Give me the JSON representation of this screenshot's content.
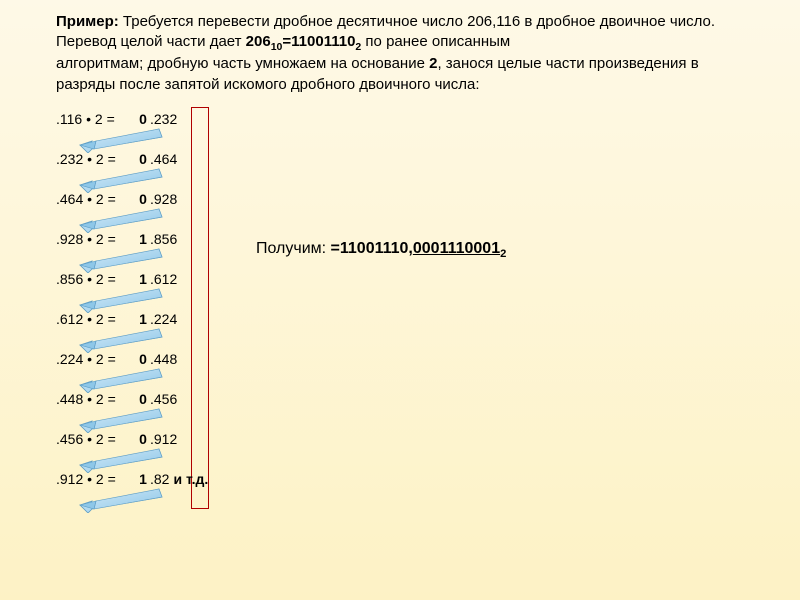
{
  "intro": {
    "example_label": "Пример:",
    "example_text": " Требуется перевести дробное десятичное число 206,116 в дробное двоичное число.",
    "line2_a": "Перевод целой части дает ",
    "int_part": "206",
    "int_base": "10",
    "eq": "=",
    "bin_part": "11001110",
    "bin_base": "2",
    "line2_b": " по ранее описанным",
    "line3": "алгоритмам; дробную часть умножаем на основание ",
    "base2": "2",
    "line3_b": ", занося целые части произведения в разряды после запятой искомого дробного двоичного числа:"
  },
  "calcs": [
    {
      "lhs": ".116 • 2 = ",
      "d": "0",
      "rhs": ".232"
    },
    {
      "lhs": ".232 • 2 = ",
      "d": "0",
      "rhs": ".464"
    },
    {
      "lhs": ".464 • 2 = ",
      "d": "0",
      "rhs": ".928"
    },
    {
      "lhs": ".928 • 2 = ",
      "d": "1",
      "rhs": ".856"
    },
    {
      "lhs": ".856 • 2 = ",
      "d": "1",
      "rhs": ".612"
    },
    {
      "lhs": ".612 • 2 = ",
      "d": "1",
      "rhs": ".224"
    },
    {
      "lhs": ".224 • 2 = ",
      "d": "0",
      "rhs": ".448"
    },
    {
      "lhs": ".448 • 2 = ",
      "d": "0",
      "rhs": ".456"
    },
    {
      "lhs": ".456 • 2 = ",
      "d": "0",
      "rhs": ".912"
    },
    {
      "lhs": ".912 • 2 = ",
      "d": "1",
      "rhs": ".82",
      "etc": "  и т.д."
    }
  ],
  "result": {
    "label": "Получим: ",
    "eq": "=11001110,",
    "frac": "0001110001",
    "base": "2"
  }
}
